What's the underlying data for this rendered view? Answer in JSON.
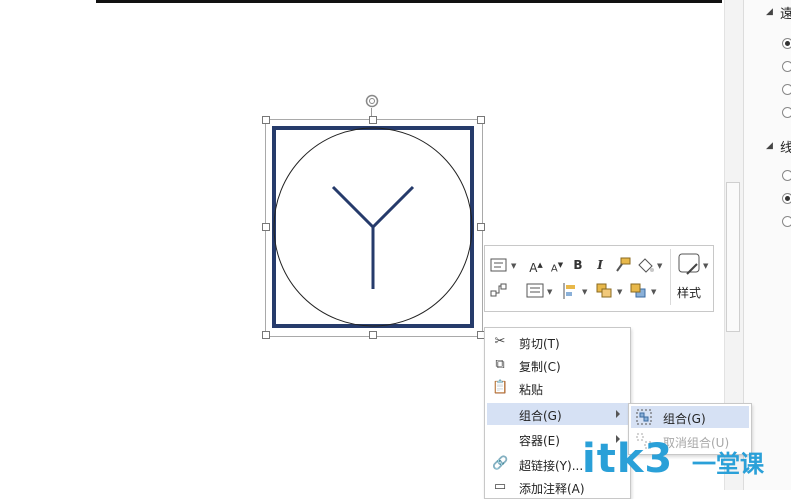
{
  "right_panel": {
    "section1_head": "遠",
    "section2_head": "线",
    "radios_group1": [
      true,
      false,
      false,
      false
    ],
    "radios_group2": [
      false,
      true,
      false
    ]
  },
  "mini_toolbar": {
    "style_label": "样式",
    "bold": "B",
    "italic": "I",
    "grow_font": "A",
    "shrink_font": "A"
  },
  "context_menu": {
    "items": [
      {
        "label": "剪切(T)",
        "icon": "scissors-icon"
      },
      {
        "label": "复制(C)",
        "icon": "copy-icon"
      },
      {
        "label": "粘贴",
        "icon": "paste-icon"
      },
      {
        "label": "组合(G)",
        "icon": "",
        "has_submenu": true,
        "highlighted": true
      },
      {
        "label": "容器(E)",
        "icon": "",
        "has_submenu": true
      },
      {
        "label": "超链接(Y)...",
        "icon": "hyperlink-icon"
      },
      {
        "label": "添加注释(A)",
        "icon": "comment-icon"
      }
    ]
  },
  "submenu": {
    "items": [
      {
        "label": "组合(G)",
        "icon": "group-icon",
        "highlighted": true,
        "disabled": false
      },
      {
        "label": "取消组合(U)",
        "icon": "ungroup-icon",
        "highlighted": false,
        "disabled": true
      }
    ]
  },
  "watermark": {
    "text": "itk3",
    "cn": "一堂课"
  },
  "colors": {
    "shape_stroke": "#263b6b",
    "menu_highlight": "#d6e1f4",
    "watermark": "#2aa0d8"
  }
}
